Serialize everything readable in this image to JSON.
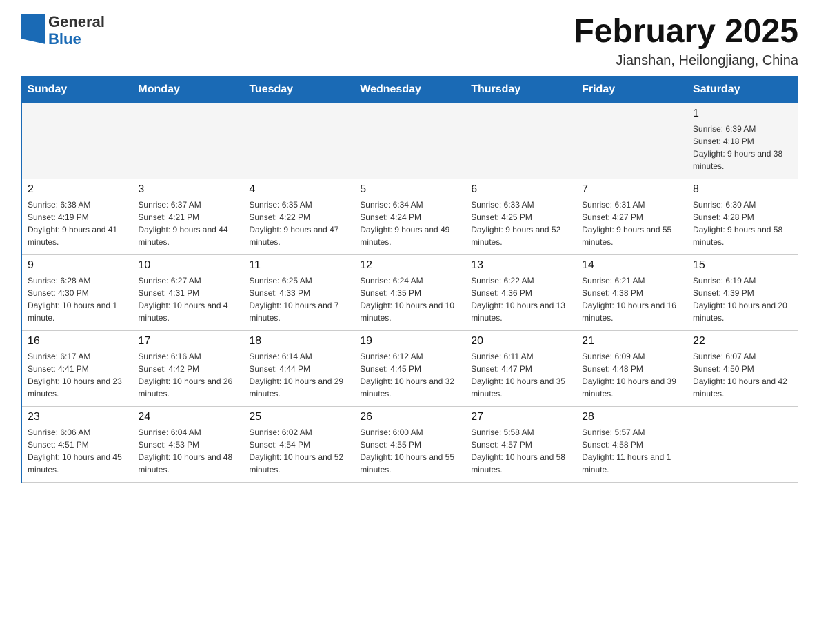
{
  "logo": {
    "text_general": "General",
    "text_blue": "Blue"
  },
  "header": {
    "month_year": "February 2025",
    "location": "Jianshan, Heilongjiang, China"
  },
  "weekdays": [
    "Sunday",
    "Monday",
    "Tuesday",
    "Wednesday",
    "Thursday",
    "Friday",
    "Saturday"
  ],
  "weeks": [
    [
      {
        "day": "",
        "info": ""
      },
      {
        "day": "",
        "info": ""
      },
      {
        "day": "",
        "info": ""
      },
      {
        "day": "",
        "info": ""
      },
      {
        "day": "",
        "info": ""
      },
      {
        "day": "",
        "info": ""
      },
      {
        "day": "1",
        "info": "Sunrise: 6:39 AM\nSunset: 4:18 PM\nDaylight: 9 hours and 38 minutes."
      }
    ],
    [
      {
        "day": "2",
        "info": "Sunrise: 6:38 AM\nSunset: 4:19 PM\nDaylight: 9 hours and 41 minutes."
      },
      {
        "day": "3",
        "info": "Sunrise: 6:37 AM\nSunset: 4:21 PM\nDaylight: 9 hours and 44 minutes."
      },
      {
        "day": "4",
        "info": "Sunrise: 6:35 AM\nSunset: 4:22 PM\nDaylight: 9 hours and 47 minutes."
      },
      {
        "day": "5",
        "info": "Sunrise: 6:34 AM\nSunset: 4:24 PM\nDaylight: 9 hours and 49 minutes."
      },
      {
        "day": "6",
        "info": "Sunrise: 6:33 AM\nSunset: 4:25 PM\nDaylight: 9 hours and 52 minutes."
      },
      {
        "day": "7",
        "info": "Sunrise: 6:31 AM\nSunset: 4:27 PM\nDaylight: 9 hours and 55 minutes."
      },
      {
        "day": "8",
        "info": "Sunrise: 6:30 AM\nSunset: 4:28 PM\nDaylight: 9 hours and 58 minutes."
      }
    ],
    [
      {
        "day": "9",
        "info": "Sunrise: 6:28 AM\nSunset: 4:30 PM\nDaylight: 10 hours and 1 minute."
      },
      {
        "day": "10",
        "info": "Sunrise: 6:27 AM\nSunset: 4:31 PM\nDaylight: 10 hours and 4 minutes."
      },
      {
        "day": "11",
        "info": "Sunrise: 6:25 AM\nSunset: 4:33 PM\nDaylight: 10 hours and 7 minutes."
      },
      {
        "day": "12",
        "info": "Sunrise: 6:24 AM\nSunset: 4:35 PM\nDaylight: 10 hours and 10 minutes."
      },
      {
        "day": "13",
        "info": "Sunrise: 6:22 AM\nSunset: 4:36 PM\nDaylight: 10 hours and 13 minutes."
      },
      {
        "day": "14",
        "info": "Sunrise: 6:21 AM\nSunset: 4:38 PM\nDaylight: 10 hours and 16 minutes."
      },
      {
        "day": "15",
        "info": "Sunrise: 6:19 AM\nSunset: 4:39 PM\nDaylight: 10 hours and 20 minutes."
      }
    ],
    [
      {
        "day": "16",
        "info": "Sunrise: 6:17 AM\nSunset: 4:41 PM\nDaylight: 10 hours and 23 minutes."
      },
      {
        "day": "17",
        "info": "Sunrise: 6:16 AM\nSunset: 4:42 PM\nDaylight: 10 hours and 26 minutes."
      },
      {
        "day": "18",
        "info": "Sunrise: 6:14 AM\nSunset: 4:44 PM\nDaylight: 10 hours and 29 minutes."
      },
      {
        "day": "19",
        "info": "Sunrise: 6:12 AM\nSunset: 4:45 PM\nDaylight: 10 hours and 32 minutes."
      },
      {
        "day": "20",
        "info": "Sunrise: 6:11 AM\nSunset: 4:47 PM\nDaylight: 10 hours and 35 minutes."
      },
      {
        "day": "21",
        "info": "Sunrise: 6:09 AM\nSunset: 4:48 PM\nDaylight: 10 hours and 39 minutes."
      },
      {
        "day": "22",
        "info": "Sunrise: 6:07 AM\nSunset: 4:50 PM\nDaylight: 10 hours and 42 minutes."
      }
    ],
    [
      {
        "day": "23",
        "info": "Sunrise: 6:06 AM\nSunset: 4:51 PM\nDaylight: 10 hours and 45 minutes."
      },
      {
        "day": "24",
        "info": "Sunrise: 6:04 AM\nSunset: 4:53 PM\nDaylight: 10 hours and 48 minutes."
      },
      {
        "day": "25",
        "info": "Sunrise: 6:02 AM\nSunset: 4:54 PM\nDaylight: 10 hours and 52 minutes."
      },
      {
        "day": "26",
        "info": "Sunrise: 6:00 AM\nSunset: 4:55 PM\nDaylight: 10 hours and 55 minutes."
      },
      {
        "day": "27",
        "info": "Sunrise: 5:58 AM\nSunset: 4:57 PM\nDaylight: 10 hours and 58 minutes."
      },
      {
        "day": "28",
        "info": "Sunrise: 5:57 AM\nSunset: 4:58 PM\nDaylight: 11 hours and 1 minute."
      },
      {
        "day": "",
        "info": ""
      }
    ]
  ]
}
